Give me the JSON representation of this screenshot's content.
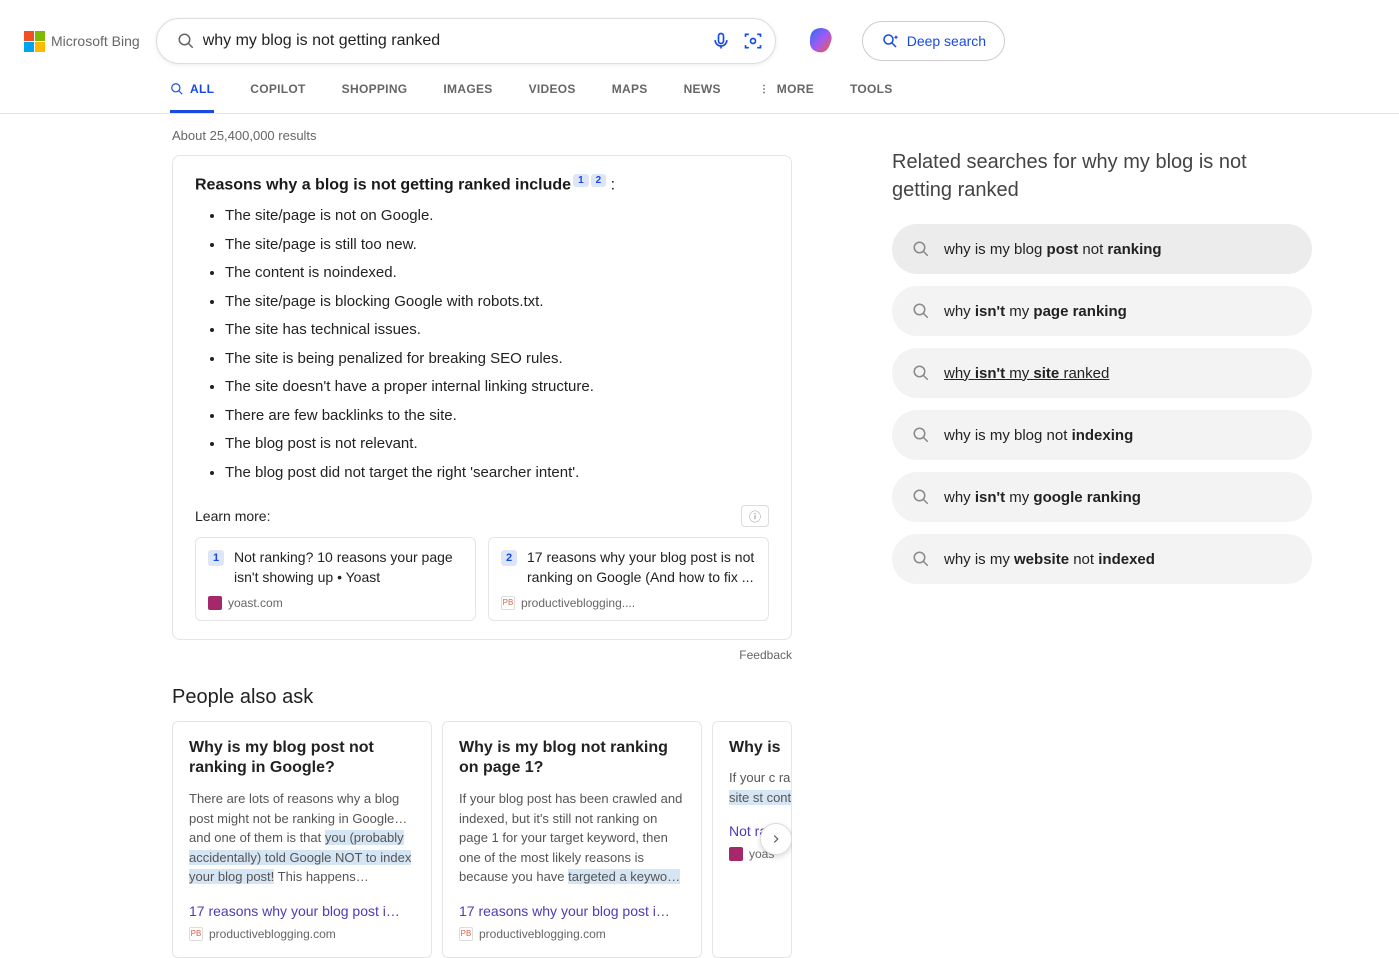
{
  "brand": "Microsoft Bing",
  "search_query": "why my blog is not getting ranked",
  "deep_search_label": "Deep search",
  "nav_tabs": [
    "ALL",
    "COPILOT",
    "SHOPPING",
    "IMAGES",
    "VIDEOS",
    "MAPS",
    "NEWS",
    "MORE",
    "TOOLS"
  ],
  "results_count": "About 25,400,000 results",
  "answer": {
    "title": "Reasons why a blog is not getting ranked include",
    "colon": " :",
    "citations": [
      "1",
      "2"
    ],
    "items": [
      "The site/page is not on Google.",
      "The site/page is still too new.",
      "The content is noindexed.",
      "The site/page is blocking Google with robots.txt.",
      "The site has technical issues.",
      "The site is being penalized for breaking SEO rules.",
      "The site doesn't have a proper internal linking structure.",
      "There are few backlinks to the site.",
      "The blog post is not relevant.",
      "The blog post did not target the right 'searcher intent'."
    ],
    "learn_more_label": "Learn more:",
    "learn_cards": [
      {
        "num": "1",
        "title": "Not ranking? 10 reasons your page isn't showing up • Yoast",
        "source": "yoast.com",
        "favicon_color": "#a4286a"
      },
      {
        "num": "2",
        "title": "17 reasons why your blog post is not ranking on Google (And how to fix ...",
        "source": "productiveblogging....",
        "favicon_text": "PB"
      }
    ]
  },
  "feedback_label": "Feedback",
  "paa": {
    "title": "People also ask",
    "cards": [
      {
        "q": "Why is my blog post not ranking in Google?",
        "snippet_pre": "There are lots of reasons why a blog post might not be ranking in Google… and one of them is that ",
        "snippet_hl": "you (probably accidentally) told Google NOT to index your blog post!",
        "snippet_post": " This happens…",
        "link": "17 reasons why your blog post i…",
        "source": "productiveblogging.com",
        "favicon_text": "PB"
      },
      {
        "q": "Why is my blog not ranking on page 1?",
        "snippet_pre": "If your blog post has been crawled and indexed, but it's still not ranking on page 1 for your target keyword, then one of the most likely reasons is because you have ",
        "snippet_hl": "targeted a keywo…",
        "snippet_post": "",
        "link": "17 reasons why your blog post i…",
        "source": "productiveblogging.com",
        "favicon_text": "PB"
      },
      {
        "q": "Why is",
        "snippet_pre": "If your c ranking, pages fr becau ",
        "snippet_hl": "site st content",
        "snippet_post": "",
        "link": "Not ran",
        "source": "yoas",
        "favicon_color": "#a4286a"
      }
    ]
  },
  "related": {
    "title_prefix": "Related searches for ",
    "title_query": "why my blog is not getting ranked",
    "items": [
      {
        "parts": [
          "why is my blog ",
          "post",
          " not ",
          "ranking"
        ],
        "bold": [
          false,
          true,
          false,
          true
        ],
        "hover": true
      },
      {
        "parts": [
          "why ",
          "isn't",
          " my ",
          "page ranking"
        ],
        "bold": [
          false,
          true,
          false,
          true
        ]
      },
      {
        "parts": [
          "why ",
          "isn't",
          " my ",
          "site",
          " ranked"
        ],
        "bold": [
          false,
          true,
          false,
          true,
          false
        ],
        "underline": true
      },
      {
        "parts": [
          "why is my blog not ",
          "indexing"
        ],
        "bold": [
          false,
          true
        ]
      },
      {
        "parts": [
          "why ",
          "isn't",
          " my ",
          "google ranking"
        ],
        "bold": [
          false,
          true,
          false,
          true
        ]
      },
      {
        "parts": [
          "why is my ",
          "website",
          " not ",
          "indexed"
        ],
        "bold": [
          false,
          true,
          false,
          true
        ]
      }
    ]
  }
}
